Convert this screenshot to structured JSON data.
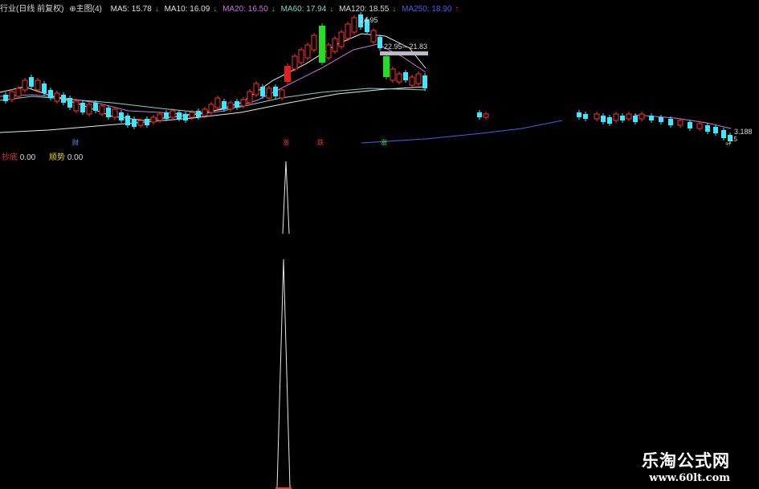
{
  "main_chart": {
    "prefix": "行业(日线 前复权)",
    "chart_label": "主图(4)",
    "ma5": "MA5: 15.78",
    "ma10": "MA10: 16.09",
    "ma20": "MA20: 16.50",
    "ma60": "MA60: 17.94",
    "ma120": "MA120: 18.55",
    "ma250": "MA250: 18.90",
    "high_label": "24.95",
    "range_label": "22.95—21.83",
    "last_label": "3.188",
    "low_label": "15",
    "tag_cai": "财",
    "tag_zhang1": "涨",
    "tag_die": "跌",
    "tag_zhang2": "涨",
    "tag_bottom": "跌"
  },
  "indicator": {
    "name1": "抄底",
    "value1": "0.00",
    "name2": "顺势",
    "value2": "0.00"
  },
  "watermark": {
    "title": "乐淘公式网",
    "url": "www.60lt.com"
  },
  "colors": {
    "up": "#ff3030",
    "down": "#40e8ff",
    "big_down": "#20e020",
    "ma20": "#d070e0",
    "ma60": "#7fd6c8",
    "ma250": "#4a5cf0",
    "signal": "#e8e8e8"
  }
}
